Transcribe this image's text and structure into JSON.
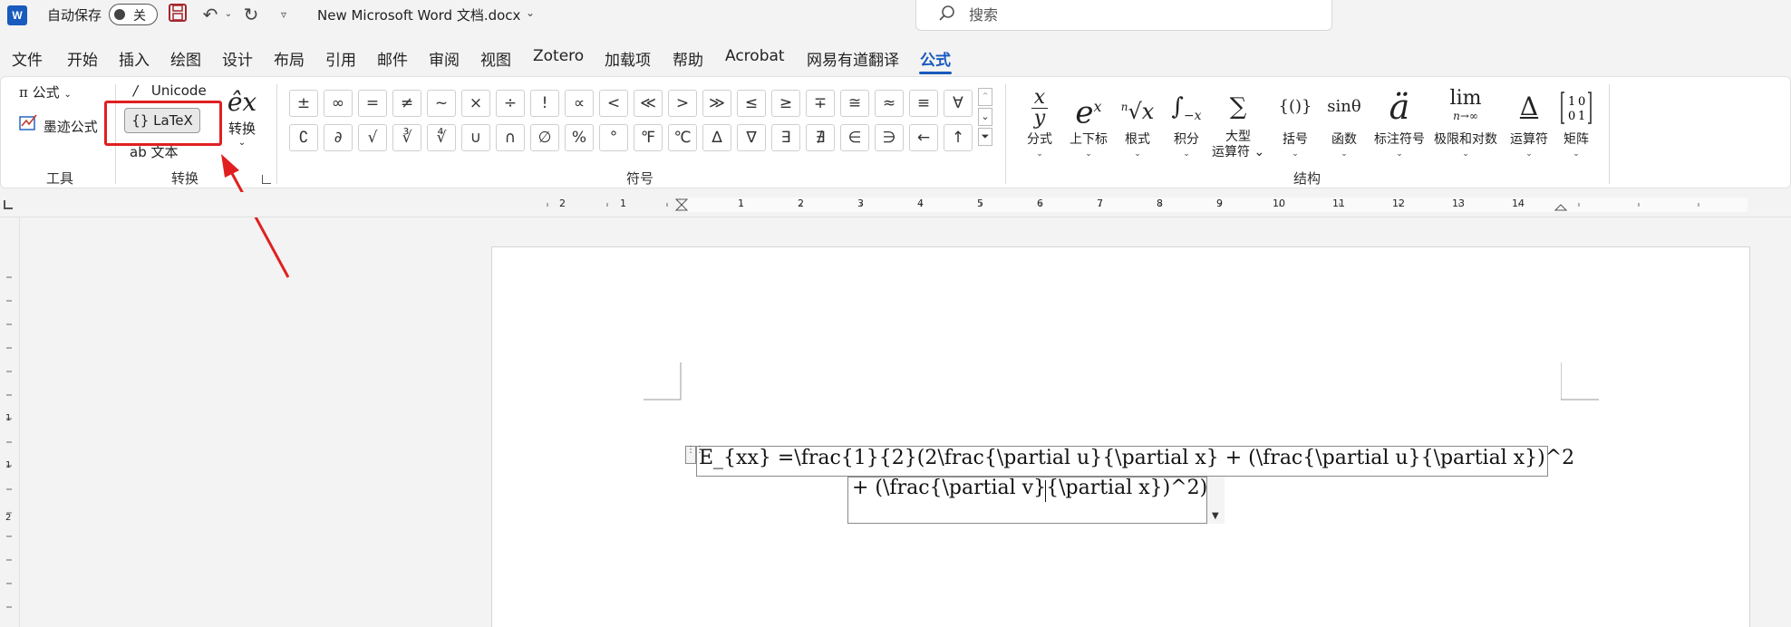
{
  "titlebar": {
    "app_icon": "W",
    "autosave_label": "自动保存",
    "autosave_state": "关",
    "doc_title": "New Microsoft Word 文档.docx",
    "search_placeholder": "搜索",
    "icons": [
      "save-icon",
      "undo-icon",
      "redo-icon",
      "customize-qat-icon",
      "search-icon"
    ]
  },
  "tabs": [
    "文件",
    "开始",
    "插入",
    "绘图",
    "设计",
    "布局",
    "引用",
    "邮件",
    "审阅",
    "视图",
    "Zotero",
    "加载项",
    "帮助",
    "Acrobat",
    "网易有道翻译",
    "公式"
  ],
  "active_tab": "公式",
  "ribbon": {
    "tools": {
      "group_label": "工具",
      "formula_button": "公式",
      "ink_formula": "墨迹公式"
    },
    "convert": {
      "group_label": "转换",
      "unicode": "Unicode",
      "latex": "LaTeX",
      "text": "文本",
      "convert_button": "转换",
      "convert_glyph": "êx"
    },
    "symbols": {
      "group_label": "符号",
      "row1": [
        "±",
        "∞",
        "=",
        "≠",
        "~",
        "×",
        "÷",
        "!",
        "∝",
        "<",
        "≪",
        ">",
        "≫",
        "≤",
        "≥",
        "∓",
        "≅",
        "≈",
        "≡",
        "∀"
      ],
      "row2": [
        "∁",
        "∂",
        "√",
        "∛",
        "∜",
        "∪",
        "∩",
        "∅",
        "%",
        "°",
        "℉",
        "℃",
        "∆",
        "∇",
        "∃",
        "∄",
        "∈",
        "∋",
        "←",
        "↑"
      ]
    },
    "structures": {
      "group_label": "结构",
      "items": [
        {
          "label": "分式",
          "glyph": "x/y"
        },
        {
          "label": "上下标",
          "glyph": "eˣ"
        },
        {
          "label": "根式",
          "glyph": "ⁿ√x"
        },
        {
          "label": "积分",
          "glyph": "∫ˣ₋ₓ"
        },
        {
          "label": "大型\n运算符",
          "glyph": "∑"
        },
        {
          "label": "括号",
          "glyph": "{()}"
        },
        {
          "label": "函数",
          "glyph": "sinθ"
        },
        {
          "label": "标注符号",
          "glyph": "ä"
        },
        {
          "label": "极限和对数",
          "glyph": "lim"
        },
        {
          "label": "运算符",
          "glyph": "Δ"
        },
        {
          "label": "矩阵",
          "glyph": "[10 01]"
        }
      ]
    }
  },
  "ruler": {
    "numbers": [
      "1",
      "2",
      "1",
      "1",
      "2",
      "3",
      "4",
      "5",
      "6",
      "7",
      "8",
      "9",
      "10",
      "11",
      "12",
      "13",
      "14"
    ],
    "vnumbers": [
      "1",
      "1",
      "2"
    ]
  },
  "document": {
    "equation_line1": "E_{xx} =\\frac{1}{2}(2\\frac{\\partial u}{\\partial x} + (\\frac{\\partial u}{\\partial x})^2",
    "equation_line2": "+ (\\frac{\\partial v}{\\partial x})^2)"
  },
  "annotation": {
    "highlight_color": "#e02020",
    "target": "LaTeX"
  },
  "colors": {
    "accent": "#185abd",
    "highlight": "#e02020"
  }
}
